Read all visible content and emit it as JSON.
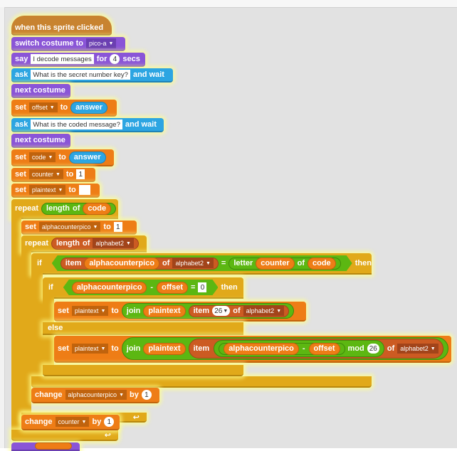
{
  "script": {
    "hat": {
      "label": "when this sprite clicked"
    },
    "switch_costume": {
      "label": "switch costume to",
      "costume": "pico-a"
    },
    "say": {
      "label": "say",
      "message": "I decode messages",
      "for_label": "for",
      "secs": "4",
      "secs_label": "secs"
    },
    "ask1": {
      "label": "ask",
      "question": "What is the secret number key?",
      "wait_label": "and wait"
    },
    "next_costume1": {
      "label": "next costume"
    },
    "set_offset": {
      "label": "set",
      "variable": "offset",
      "to_label": "to",
      "value": "answer"
    },
    "ask2": {
      "label": "ask",
      "question": "What is the coded message?",
      "wait_label": "and wait"
    },
    "next_costume2": {
      "label": "next costume"
    },
    "set_code": {
      "label": "set",
      "variable": "code",
      "to_label": "to",
      "value": "answer"
    },
    "set_counter": {
      "label": "set",
      "variable": "counter",
      "to_label": "to",
      "value": "1"
    },
    "set_plaintext": {
      "label": "set",
      "variable": "plaintext",
      "to_label": "to",
      "value": ""
    },
    "repeat_outer": {
      "label": "repeat",
      "length_label": "length",
      "of_label": "of",
      "variable": "code"
    },
    "set_alpha": {
      "label": "set",
      "variable": "alphacounterpico",
      "to_label": "to",
      "value": "1"
    },
    "repeat_inner": {
      "label": "repeat",
      "length_label": "length",
      "of_label": "of",
      "list": "alphabet2"
    },
    "if_outer": {
      "label": "if",
      "item_label": "item",
      "item_var": "alphacounterpico",
      "of_label": "of",
      "list": "alphabet2",
      "eq": "=",
      "letter_label": "letter",
      "letter_var": "counter",
      "of2_label": "of",
      "letter_of": "code",
      "then_label": "then"
    },
    "if_inner": {
      "label": "if",
      "left_var": "alphacounterpico",
      "minus": "-",
      "right_var": "offset",
      "eq": "=",
      "value": "0",
      "then_label": "then"
    },
    "set_plain_then": {
      "label": "set",
      "variable": "plaintext",
      "to_label": "to",
      "join_label": "join",
      "join_var": "plaintext",
      "item_label": "item",
      "item_index": "26",
      "of_label": "of",
      "list": "alphabet2"
    },
    "else_label": "else",
    "set_plain_else": {
      "label": "set",
      "variable": "plaintext",
      "to_label": "to",
      "join_label": "join",
      "join_var": "plaintext",
      "item_label": "item",
      "left_var": "alphacounterpico",
      "minus": "-",
      "right_var": "offset",
      "mod_label": "mod",
      "mod_value": "26",
      "of_label": "of",
      "list": "alphabet2"
    },
    "change_alpha": {
      "label": "change",
      "variable": "alphacounterpico",
      "by_label": "by",
      "value": "1"
    },
    "change_counter": {
      "label": "change",
      "variable": "counter",
      "by_label": "by",
      "value": "1"
    },
    "loop_arrow": "↩"
  }
}
